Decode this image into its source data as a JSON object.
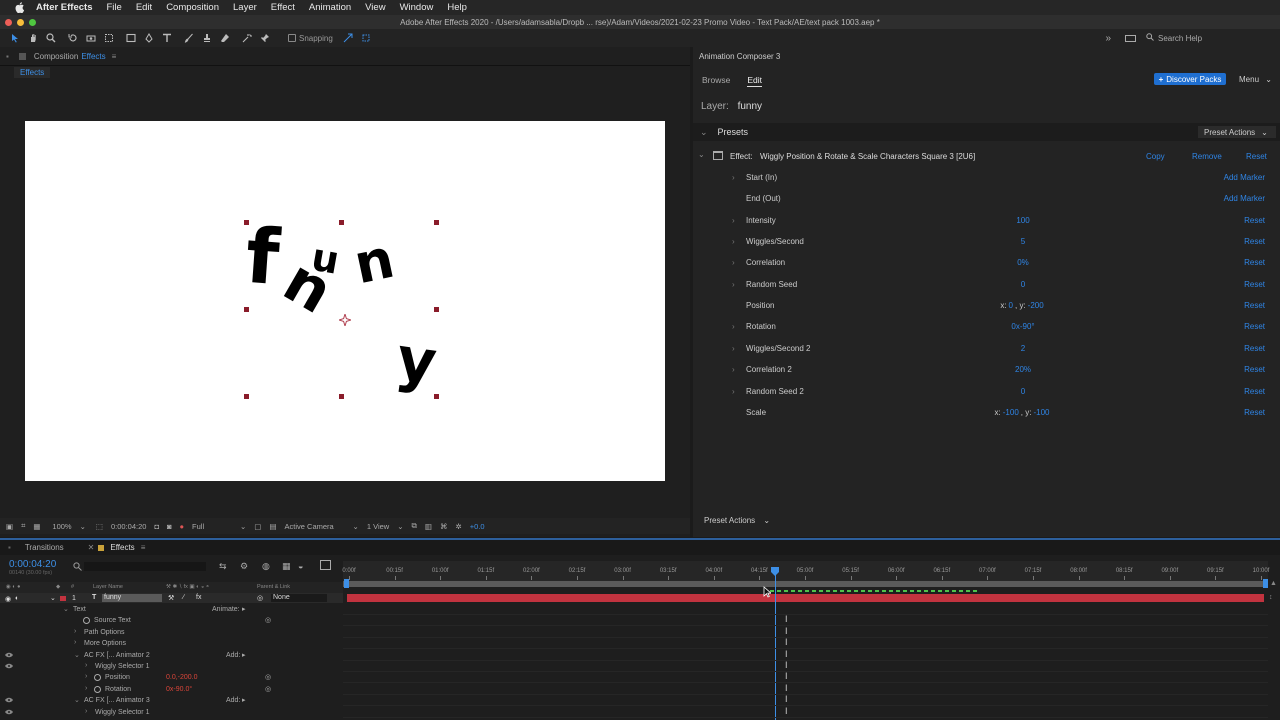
{
  "menubar": {
    "items": [
      "After Effects",
      "File",
      "Edit",
      "Composition",
      "Layer",
      "Effect",
      "Animation",
      "View",
      "Window",
      "Help"
    ]
  },
  "titlebar": {
    "title": "Adobe After Effects 2020 - /Users/adamsabla/Dropb ... rse)/Adam/Videos/2021-02-23 Promo Video - Text Pack/AE/text pack 1003.aep *"
  },
  "toolbar": {
    "snapping_label": "Snapping",
    "search_placeholder": "Search Help"
  },
  "composition": {
    "panel_label": "Composition",
    "panel_name": "Effects",
    "tab": "Effects",
    "glyphs": [
      "f",
      "u",
      "n",
      "n",
      "y"
    ],
    "footer": {
      "zoom": "100%",
      "timecode": "0:00:04:20",
      "resolution": "Full",
      "camera": "Active Camera",
      "views": "1 View",
      "exposure": "+0.0"
    }
  },
  "animation_composer": {
    "title": "Animation Composer 3",
    "tabs": [
      "Browse",
      "Edit"
    ],
    "active_tab": "Edit",
    "discover_label": "Discover Packs",
    "menu_label": "Menu",
    "layer_label": "Layer:",
    "layer_name": "funny",
    "presets_label": "Presets",
    "preset_actions_label": "Preset Actions",
    "effect_label": "Effect:",
    "effect_name": "Wiggly Position & Rotate & Scale Characters Square 3 [2U6]",
    "effect_actions": [
      "Copy",
      "Remove",
      "Reset"
    ],
    "params": [
      {
        "name": "Start (In)",
        "value": "",
        "action": "Add Marker",
        "expandable": true
      },
      {
        "name": "End (Out)",
        "value": "",
        "action": "Add Marker",
        "expandable": false
      },
      {
        "name": "Intensity",
        "value": "100",
        "action": "Reset",
        "expandable": true
      },
      {
        "name": "Wiggles/Second",
        "value": "5",
        "action": "Reset",
        "expandable": true
      },
      {
        "name": "Correlation",
        "value": "0%",
        "action": "Reset",
        "expandable": true
      },
      {
        "name": "Random Seed",
        "value": "0",
        "action": "Reset",
        "expandable": true
      },
      {
        "name": "Position",
        "value": "",
        "action": "Reset",
        "expandable": false
      },
      {
        "name": "Rotation",
        "value": "0x-90°",
        "action": "Reset",
        "expandable": true
      },
      {
        "name": "Wiggles/Second 2",
        "value": "2",
        "action": "Reset",
        "expandable": true
      },
      {
        "name": "Correlation 2",
        "value": "20%",
        "action": "Reset",
        "expandable": true
      },
      {
        "name": "Random Seed 2",
        "value": "0",
        "action": "Reset",
        "expandable": true
      },
      {
        "name": "Scale",
        "value": "",
        "action": "Reset",
        "expandable": false
      }
    ],
    "position_value": {
      "x_label": "x:",
      "x": "0",
      "y_label": ", y:",
      "y": "-200"
    },
    "scale_value": {
      "x_label": "x:",
      "x": "-100",
      "y_label": ", y:",
      "y": "-100"
    },
    "footer_label": "Preset Actions"
  },
  "timeline": {
    "tabs": [
      "Transitions",
      "Effects"
    ],
    "active_tab": "Effects",
    "timecode": "0:00:04:20",
    "timecode_sub": "00140 (30.00 fps)",
    "column_headers": {
      "num": "#",
      "layer_name": "Layer Name",
      "parent": "Parent & Link"
    },
    "ruler_ticks": [
      "0:00f",
      "00:15f",
      "01:00f",
      "01:15f",
      "02:00f",
      "02:15f",
      "03:00f",
      "03:15f",
      "04:00f",
      "04:15f",
      "05:00f",
      "05:15f",
      "06:00f",
      "06:15f",
      "07:00f",
      "07:15f",
      "08:00f",
      "08:15f",
      "09:00f",
      "09:15f",
      "10:00f"
    ],
    "layer": {
      "num": "1",
      "name": "funny",
      "parent": "None"
    },
    "rows": [
      {
        "label": "Text",
        "indent": 1,
        "right": "Animate:",
        "eye": false,
        "twirl": "open"
      },
      {
        "label": "Source Text",
        "indent": 2,
        "right": "",
        "eye": false,
        "twirl": "none"
      },
      {
        "label": "Path Options",
        "indent": 2,
        "right": "",
        "eye": false,
        "twirl": "closed"
      },
      {
        "label": "More Options",
        "indent": 2,
        "right": "",
        "eye": false,
        "twirl": "closed"
      },
      {
        "label": "AC FX [... Animator 2",
        "indent": 2,
        "right": "Add:",
        "eye": true,
        "twirl": "open"
      },
      {
        "label": "Wiggly Selector 1",
        "indent": 3,
        "right": "",
        "eye": true,
        "twirl": "closed"
      },
      {
        "label": "Position",
        "indent": 3,
        "right": "",
        "eye": false,
        "twirl": "closed",
        "value": "0.0,-200.0"
      },
      {
        "label": "Rotation",
        "indent": 3,
        "right": "",
        "eye": false,
        "twirl": "closed",
        "value": "0x-90.0°"
      },
      {
        "label": "AC FX [... Animator 3",
        "indent": 2,
        "right": "Add:",
        "eye": true,
        "twirl": "open"
      },
      {
        "label": "Wiggly Selector 1",
        "indent": 3,
        "right": "",
        "eye": true,
        "twirl": "closed"
      }
    ],
    "playhead_time": "04:20f"
  },
  "colors": {
    "accent": "#2f85e6",
    "layer_bar": "#c2333f",
    "handle": "#8a1c2a",
    "discover": "#1f6fd1"
  }
}
